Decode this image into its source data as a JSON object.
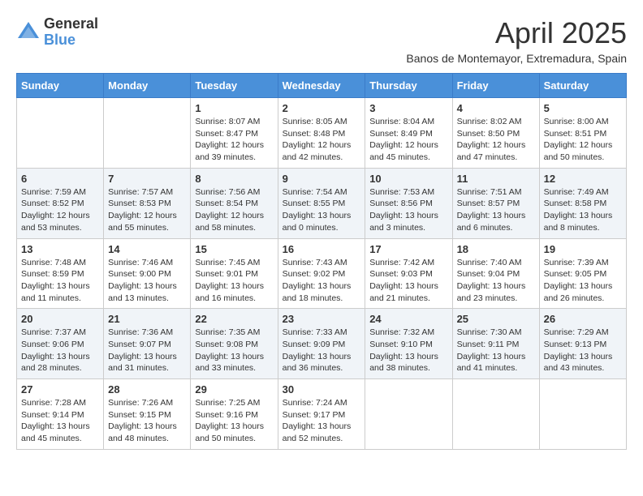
{
  "logo": {
    "general": "General",
    "blue": "Blue"
  },
  "title": "April 2025",
  "subtitle": "Banos de Montemayor, Extremadura, Spain",
  "days_of_week": [
    "Sunday",
    "Monday",
    "Tuesday",
    "Wednesday",
    "Thursday",
    "Friday",
    "Saturday"
  ],
  "weeks": [
    [
      {
        "day": "",
        "info": ""
      },
      {
        "day": "",
        "info": ""
      },
      {
        "day": "1",
        "info": "Sunrise: 8:07 AM\nSunset: 8:47 PM\nDaylight: 12 hours and 39 minutes."
      },
      {
        "day": "2",
        "info": "Sunrise: 8:05 AM\nSunset: 8:48 PM\nDaylight: 12 hours and 42 minutes."
      },
      {
        "day": "3",
        "info": "Sunrise: 8:04 AM\nSunset: 8:49 PM\nDaylight: 12 hours and 45 minutes."
      },
      {
        "day": "4",
        "info": "Sunrise: 8:02 AM\nSunset: 8:50 PM\nDaylight: 12 hours and 47 minutes."
      },
      {
        "day": "5",
        "info": "Sunrise: 8:00 AM\nSunset: 8:51 PM\nDaylight: 12 hours and 50 minutes."
      }
    ],
    [
      {
        "day": "6",
        "info": "Sunrise: 7:59 AM\nSunset: 8:52 PM\nDaylight: 12 hours and 53 minutes."
      },
      {
        "day": "7",
        "info": "Sunrise: 7:57 AM\nSunset: 8:53 PM\nDaylight: 12 hours and 55 minutes."
      },
      {
        "day": "8",
        "info": "Sunrise: 7:56 AM\nSunset: 8:54 PM\nDaylight: 12 hours and 58 minutes."
      },
      {
        "day": "9",
        "info": "Sunrise: 7:54 AM\nSunset: 8:55 PM\nDaylight: 13 hours and 0 minutes."
      },
      {
        "day": "10",
        "info": "Sunrise: 7:53 AM\nSunset: 8:56 PM\nDaylight: 13 hours and 3 minutes."
      },
      {
        "day": "11",
        "info": "Sunrise: 7:51 AM\nSunset: 8:57 PM\nDaylight: 13 hours and 6 minutes."
      },
      {
        "day": "12",
        "info": "Sunrise: 7:49 AM\nSunset: 8:58 PM\nDaylight: 13 hours and 8 minutes."
      }
    ],
    [
      {
        "day": "13",
        "info": "Sunrise: 7:48 AM\nSunset: 8:59 PM\nDaylight: 13 hours and 11 minutes."
      },
      {
        "day": "14",
        "info": "Sunrise: 7:46 AM\nSunset: 9:00 PM\nDaylight: 13 hours and 13 minutes."
      },
      {
        "day": "15",
        "info": "Sunrise: 7:45 AM\nSunset: 9:01 PM\nDaylight: 13 hours and 16 minutes."
      },
      {
        "day": "16",
        "info": "Sunrise: 7:43 AM\nSunset: 9:02 PM\nDaylight: 13 hours and 18 minutes."
      },
      {
        "day": "17",
        "info": "Sunrise: 7:42 AM\nSunset: 9:03 PM\nDaylight: 13 hours and 21 minutes."
      },
      {
        "day": "18",
        "info": "Sunrise: 7:40 AM\nSunset: 9:04 PM\nDaylight: 13 hours and 23 minutes."
      },
      {
        "day": "19",
        "info": "Sunrise: 7:39 AM\nSunset: 9:05 PM\nDaylight: 13 hours and 26 minutes."
      }
    ],
    [
      {
        "day": "20",
        "info": "Sunrise: 7:37 AM\nSunset: 9:06 PM\nDaylight: 13 hours and 28 minutes."
      },
      {
        "day": "21",
        "info": "Sunrise: 7:36 AM\nSunset: 9:07 PM\nDaylight: 13 hours and 31 minutes."
      },
      {
        "day": "22",
        "info": "Sunrise: 7:35 AM\nSunset: 9:08 PM\nDaylight: 13 hours and 33 minutes."
      },
      {
        "day": "23",
        "info": "Sunrise: 7:33 AM\nSunset: 9:09 PM\nDaylight: 13 hours and 36 minutes."
      },
      {
        "day": "24",
        "info": "Sunrise: 7:32 AM\nSunset: 9:10 PM\nDaylight: 13 hours and 38 minutes."
      },
      {
        "day": "25",
        "info": "Sunrise: 7:30 AM\nSunset: 9:11 PM\nDaylight: 13 hours and 41 minutes."
      },
      {
        "day": "26",
        "info": "Sunrise: 7:29 AM\nSunset: 9:13 PM\nDaylight: 13 hours and 43 minutes."
      }
    ],
    [
      {
        "day": "27",
        "info": "Sunrise: 7:28 AM\nSunset: 9:14 PM\nDaylight: 13 hours and 45 minutes."
      },
      {
        "day": "28",
        "info": "Sunrise: 7:26 AM\nSunset: 9:15 PM\nDaylight: 13 hours and 48 minutes."
      },
      {
        "day": "29",
        "info": "Sunrise: 7:25 AM\nSunset: 9:16 PM\nDaylight: 13 hours and 50 minutes."
      },
      {
        "day": "30",
        "info": "Sunrise: 7:24 AM\nSunset: 9:17 PM\nDaylight: 13 hours and 52 minutes."
      },
      {
        "day": "",
        "info": ""
      },
      {
        "day": "",
        "info": ""
      },
      {
        "day": "",
        "info": ""
      }
    ]
  ]
}
